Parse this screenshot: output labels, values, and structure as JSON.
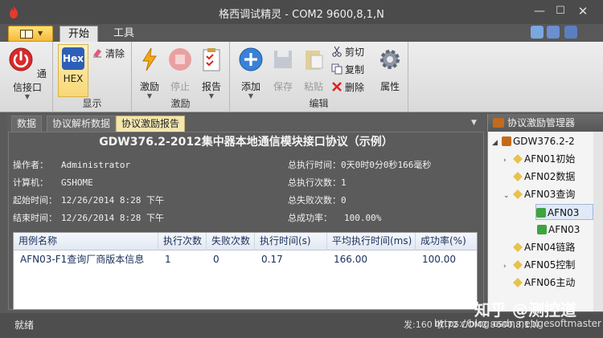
{
  "window": {
    "title": "格西调试精灵 - COM2  9600,8,1,N"
  },
  "ribbon_tabs": [
    "开始",
    "工具"
  ],
  "ribbon": {
    "groups": [
      {
        "label": "",
        "buttons": [
          {
            "label": "通信接口"
          }
        ]
      },
      {
        "label": "显示",
        "buttons": [
          {
            "label": "HEX",
            "icon_text": "Hex"
          },
          {
            "label": "清除"
          }
        ]
      },
      {
        "label": "激励",
        "buttons": [
          {
            "label": "激励"
          },
          {
            "label": "停止"
          },
          {
            "label": "报告"
          }
        ]
      },
      {
        "label": "编辑",
        "buttons": [
          {
            "label": "添加"
          },
          {
            "label": "保存"
          },
          {
            "label": "粘贴"
          },
          {
            "label": "剪切"
          },
          {
            "label": "复制"
          },
          {
            "label": "删除"
          },
          {
            "label": "属性"
          }
        ]
      }
    ]
  },
  "doc_tabs": [
    "数据",
    "协议解析数据",
    "协议激励报告"
  ],
  "report": {
    "title": "GDW376.2-2012集中器本地通信模块接口协议（示例）",
    "left": [
      {
        "key": "操作者：",
        "value": "Administrator"
      },
      {
        "key": "计算机：",
        "value": "GSHOME"
      },
      {
        "key": "起始时间：",
        "value": "12/26/2014 8:28 下午"
      },
      {
        "key": "结束时间：",
        "value": "12/26/2014 8:28 下午"
      }
    ],
    "right": [
      {
        "key": "总执行时间：",
        "value": "0天0时0分0秒166毫秒"
      },
      {
        "key": "总执行次数：",
        "value": "1"
      },
      {
        "key": "总失败次数：",
        "value": "0"
      },
      {
        "key": "总成功率：",
        "value": "100.00%"
      }
    ],
    "table": {
      "columns": [
        "用例名称",
        "执行次数",
        "失败次数",
        "执行时间(s)",
        "平均执行时间(ms)",
        "成功率(%)"
      ],
      "rows": [
        [
          "AFN03-F1查询厂商版本信息",
          "1",
          "0",
          "0.17",
          "166.00",
          "100.00"
        ]
      ]
    }
  },
  "panel": {
    "title": "协议激励管理器",
    "items": [
      "GDW376.2-2",
      "AFN01初始",
      "AFN02数据",
      "AFN03查询",
      "AFN03",
      "AFN03",
      "AFN04链路",
      "AFN05控制",
      "AFN06主动"
    ]
  },
  "statusbar": {
    "left": "就绪",
    "right": "发:160  收:72   COM2 9600,8,1,N"
  },
  "watermark": {
    "main": "知乎 @测控道",
    "sub": "https://blog.csdn.net/gesoftmaster"
  },
  "colors": {
    "title_bg": "#4b4b4b",
    "ribbon_bg": "#e6e6e6",
    "active_tab": "#f3e7b0",
    "report_bg": "#5b5b5b",
    "table_text": "#1a2f5a"
  }
}
